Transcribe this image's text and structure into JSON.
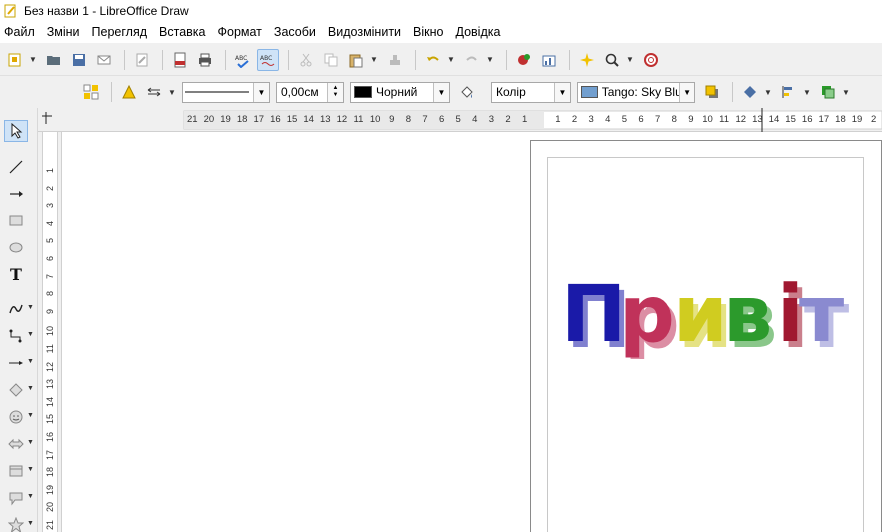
{
  "window": {
    "title": "Без назви 1 - LibreOffice Draw"
  },
  "menu": {
    "items": [
      "Файл",
      "Зміни",
      "Перегляд",
      "Вставка",
      "Формат",
      "Засоби",
      "Видозмінити",
      "Вікно",
      "Довідка"
    ]
  },
  "line_properties": {
    "line_width": "0,00см",
    "line_color_label": "Чорний",
    "line_color": "#000000",
    "fill_type": "Колір",
    "fill_color_label": "Tango: Sky Blu",
    "fill_color": "#729fcf"
  },
  "hruler": {
    "labels": [
      "21",
      "20",
      "19",
      "18",
      "17",
      "16",
      "15",
      "14",
      "13",
      "12",
      "11",
      "10",
      "9",
      "8",
      "7",
      "6",
      "5",
      "4",
      "3",
      "2",
      "1",
      "",
      "1",
      "2",
      "3",
      "4",
      "5",
      "6",
      "7",
      "8",
      "9",
      "10",
      "11",
      "12",
      "13",
      "14",
      "15",
      "16",
      "17",
      "18",
      "19",
      "2"
    ]
  },
  "vruler": {
    "labels": [
      "1",
      "2",
      "3",
      "4",
      "5",
      "6",
      "7",
      "8",
      "9",
      "10",
      "11",
      "12",
      "13",
      "14",
      "15",
      "16",
      "17",
      "18",
      "19",
      "20",
      "21",
      "22"
    ]
  },
  "drawing": {
    "word_art": {
      "letters": [
        "П",
        "р",
        "и",
        "в",
        "і",
        "т"
      ],
      "colors": [
        "#1a1aa8",
        "#c0325a",
        "#d0cc20",
        "#2c9a2c",
        "#a01830",
        "#8a8ad0"
      ]
    }
  }
}
